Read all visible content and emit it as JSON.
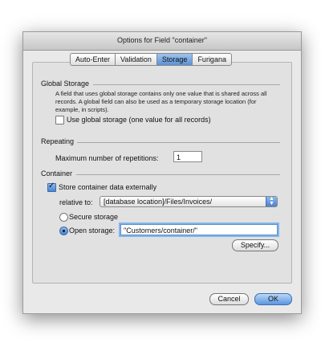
{
  "dialog": {
    "title": "Options for Field \"container\""
  },
  "tabs": [
    {
      "label": "Auto-Enter",
      "active": false
    },
    {
      "label": "Validation",
      "active": false
    },
    {
      "label": "Storage",
      "active": true
    },
    {
      "label": "Furigana",
      "active": false
    }
  ],
  "global_storage": {
    "heading": "Global Storage",
    "description": "A field that uses global storage contains only one value that is shared across all records.  A global field can also be used as a temporary storage location (for example, in scripts).",
    "checkbox_label": "Use global storage (one value for all records)",
    "checked": false
  },
  "repeating": {
    "heading": "Repeating",
    "label": "Maximum number of repetitions:",
    "value": "1"
  },
  "container": {
    "heading": "Container",
    "store_externally_label": "Store container data externally",
    "store_externally_checked": true,
    "relative_to_label": "relative to:",
    "relative_to_value": "[database location]/Files/Invoices/",
    "secure_storage_label": "Secure storage",
    "open_storage_label": "Open storage:",
    "open_storage_value": "\"Customers/container/\"",
    "selected_storage": "open",
    "specify_button": "Specify..."
  },
  "buttons": {
    "cancel": "Cancel",
    "ok": "OK"
  },
  "colors": {
    "accent": "#5a97e0",
    "dialog_bg": "#e9e9e9"
  }
}
